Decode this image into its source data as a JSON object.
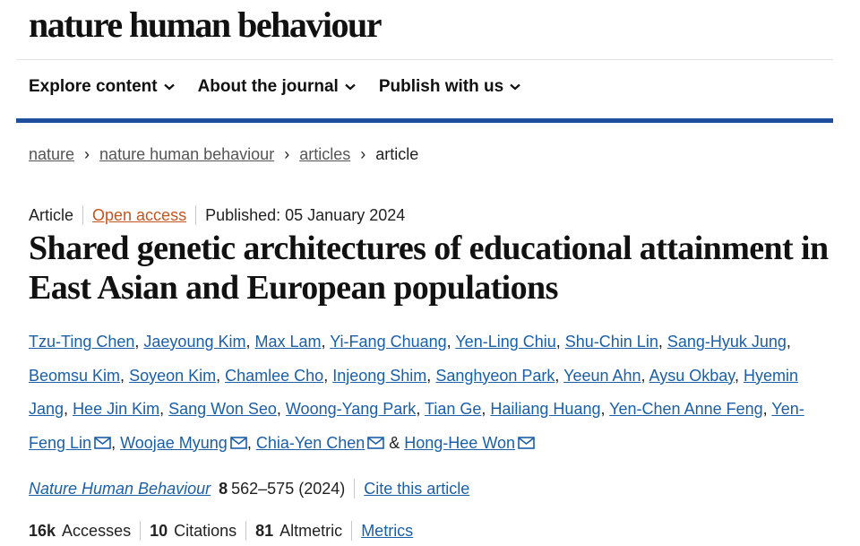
{
  "site": {
    "logo": "nature human behaviour"
  },
  "nav": {
    "items": [
      {
        "label": "Explore content"
      },
      {
        "label": "About the journal"
      },
      {
        "label": "Publish with us"
      }
    ]
  },
  "breadcrumb": {
    "items": [
      "nature",
      "nature human behaviour",
      "articles"
    ],
    "current": "article"
  },
  "article": {
    "type": "Article",
    "access": "Open access",
    "published": "Published: 05 January 2024",
    "title": "Shared genetic architectures of educational attainment in East Asian and European populations",
    "authors": [
      {
        "name": "Tzu-Ting Chen",
        "mail": false
      },
      {
        "name": "Jaeyoung Kim",
        "mail": false
      },
      {
        "name": "Max Lam",
        "mail": false
      },
      {
        "name": "Yi-Fang Chuang",
        "mail": false
      },
      {
        "name": "Yen-Ling Chiu",
        "mail": false
      },
      {
        "name": "Shu-Chin Lin",
        "mail": false
      },
      {
        "name": "Sang-Hyuk Jung",
        "mail": false
      },
      {
        "name": "Beomsu Kim",
        "mail": false
      },
      {
        "name": "Soyeon Kim",
        "mail": false
      },
      {
        "name": "Chamlee Cho",
        "mail": false
      },
      {
        "name": "Injeong Shim",
        "mail": false
      },
      {
        "name": "Sanghyeon Park",
        "mail": false
      },
      {
        "name": "Yeeun Ahn",
        "mail": false
      },
      {
        "name": "Aysu Okbay",
        "mail": false
      },
      {
        "name": "Hyemin Jang",
        "mail": false
      },
      {
        "name": "Hee Jin Kim",
        "mail": false
      },
      {
        "name": "Sang Won Seo",
        "mail": false
      },
      {
        "name": "Woong-Yang Park",
        "mail": false
      },
      {
        "name": "Tian Ge",
        "mail": false
      },
      {
        "name": "Hailiang Huang",
        "mail": false
      },
      {
        "name": "Yen-Chen Anne Feng",
        "mail": false
      },
      {
        "name": "Yen-Feng Lin",
        "mail": true
      },
      {
        "name": "Woojae Myung",
        "mail": true
      },
      {
        "name": "Chia-Yen Chen",
        "mail": true
      },
      {
        "name": "Hong-Hee Won",
        "mail": true
      }
    ],
    "journal": "Nature Human Behaviour",
    "volume": "8",
    "pages_year": "562–575 (2024)",
    "cite_label": "Cite this article",
    "metrics": {
      "accesses_value": "16k",
      "accesses_label": "Accesses",
      "citations_value": "10",
      "citations_label": "Citations",
      "altmetric_value": "81",
      "altmetric_label": "Altmetric",
      "metrics_link": "Metrics"
    }
  },
  "colors": {
    "nav_rule": "#1f4f9c",
    "link": "#1a5fa8",
    "open_access": "#c4551e"
  }
}
